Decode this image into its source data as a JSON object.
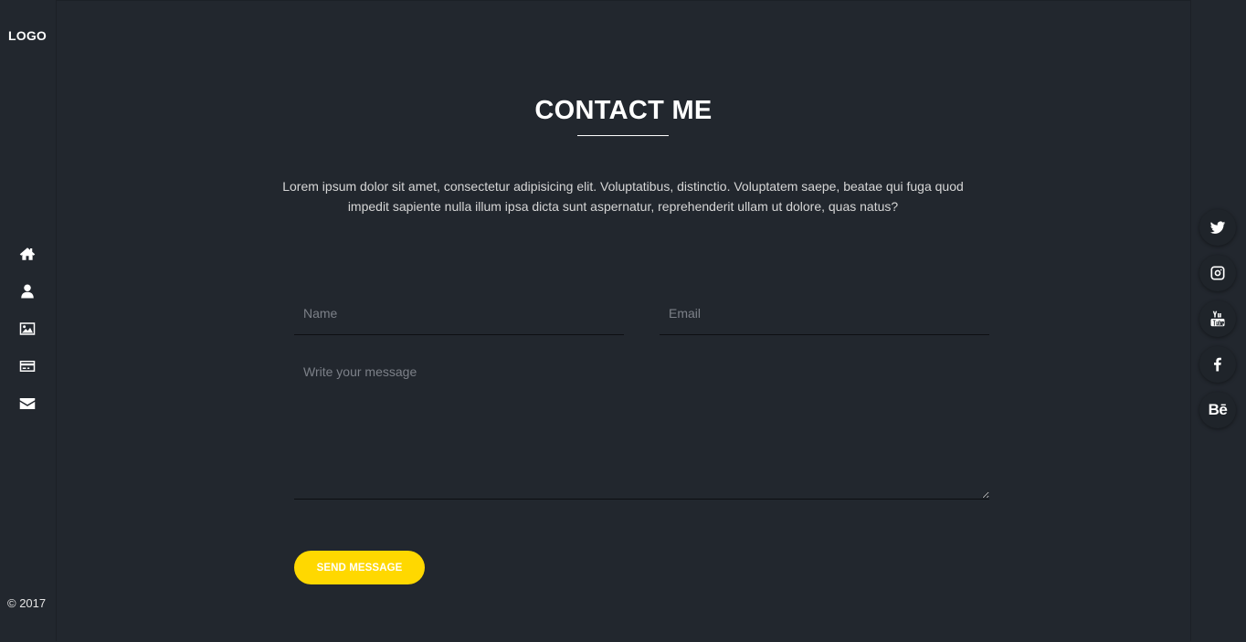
{
  "brand": {
    "logo_text": "LOGO"
  },
  "nav": {
    "items": [
      {
        "icon": "home-icon"
      },
      {
        "icon": "user-icon"
      },
      {
        "icon": "image-icon"
      },
      {
        "icon": "credit-card-icon"
      },
      {
        "icon": "envelope-icon"
      }
    ]
  },
  "footer": {
    "copyright": "© 2017"
  },
  "contact": {
    "title": "CONTACT ME",
    "intro": "Lorem ipsum dolor sit amet, consectetur adipisicing elit. Voluptatibus, distinctio. Voluptatem saepe, beatae qui fuga quod impedit sapiente nulla illum ipsa dicta sunt aspernatur, reprehenderit ullam ut dolore, quas natus?",
    "form": {
      "name_placeholder": "Name",
      "name_value": "",
      "email_placeholder": "Email",
      "email_value": "",
      "message_placeholder": "Write your message",
      "message_value": "",
      "submit_label": "SEND MESSAGE"
    }
  },
  "social": {
    "items": [
      {
        "icon": "twitter-icon"
      },
      {
        "icon": "instagram-icon"
      },
      {
        "icon": "youtube-icon"
      },
      {
        "icon": "facebook-icon"
      },
      {
        "icon": "behance-icon",
        "text": "Bē"
      }
    ]
  },
  "colors": {
    "background": "#22272e",
    "accent": "#ffd800",
    "text": "#ffffff"
  }
}
